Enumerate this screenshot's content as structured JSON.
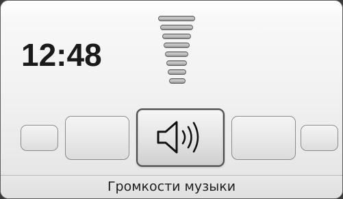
{
  "status": {
    "clock": "12:48"
  },
  "volume_indicator": {
    "level_fraction": 1.0,
    "bar_count": 8
  },
  "carousel": {
    "selected_item": "volume",
    "selected_icon": "speaker-volume-icon"
  },
  "footer": {
    "label": "Громкости музыки"
  }
}
